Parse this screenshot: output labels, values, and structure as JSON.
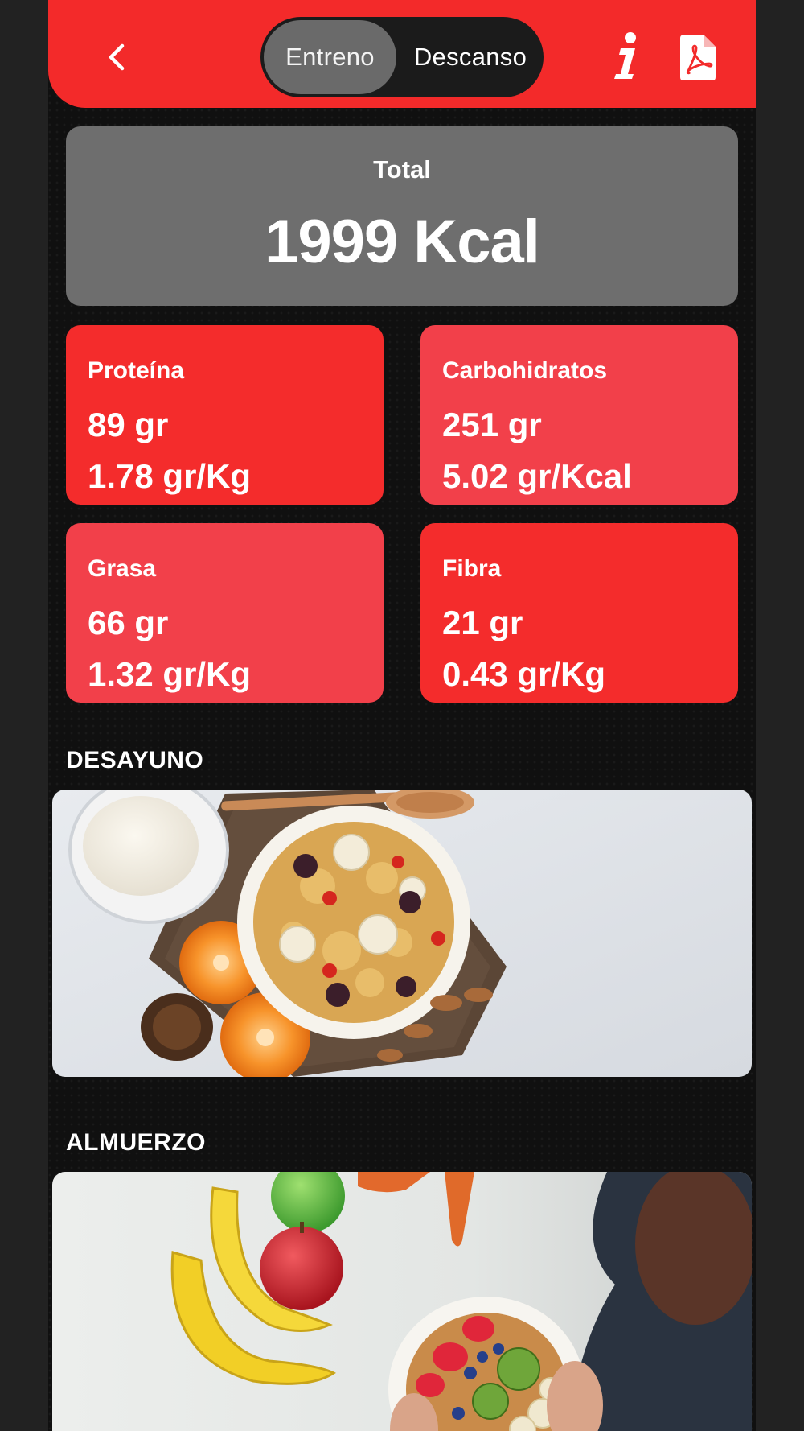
{
  "header": {
    "back_label": "Back",
    "segments": [
      {
        "label": "Entreno",
        "active": true
      },
      {
        "label": "Descanso",
        "active": false
      }
    ],
    "info_icon": "info-icon",
    "pdf_icon": "pdf-icon"
  },
  "total": {
    "label": "Total",
    "value": "1999 Kcal"
  },
  "macros": [
    {
      "label": "Proteína",
      "grams": "89 gr",
      "ratio": "1.78 gr/Kg"
    },
    {
      "label": "Carbohidratos",
      "grams": "251 gr",
      "ratio": "5.02 gr/Kcal"
    },
    {
      "label": "Grasa",
      "grams": "66 gr",
      "ratio": "1.32 gr/Kg"
    },
    {
      "label": "Fibra",
      "grams": "21 gr",
      "ratio": "0.43 gr/Kg"
    }
  ],
  "meals": [
    {
      "title": "DESAYUNO",
      "image": "breakfast-cereal-bowl-photo"
    },
    {
      "title": "ALMUERZO",
      "image": "fruit-bowl-photo"
    }
  ],
  "colors": {
    "accent_red": "#f32a2a",
    "accent_red_light": "#f2404a",
    "total_card_gray": "#6e6e6e",
    "background": "#101010"
  }
}
